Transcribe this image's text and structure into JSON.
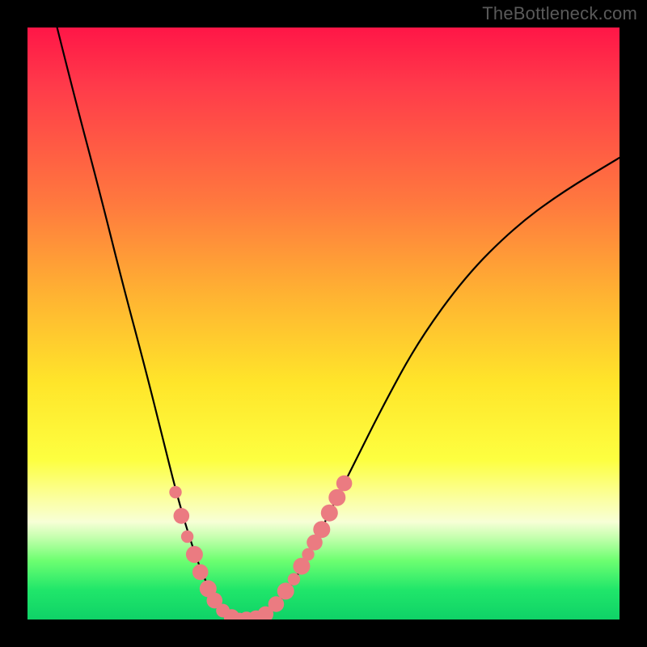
{
  "watermark": "TheBottleneck.com",
  "colors": {
    "frame": "#000000",
    "curve_stroke": "#000000",
    "bead_fill": "#eb7b81",
    "gradient_top": "#ff1647",
    "gradient_bottom": "#0fd267"
  },
  "chart_data": {
    "type": "line",
    "title": "",
    "xlabel": "",
    "ylabel": "",
    "xlim": [
      0,
      100
    ],
    "ylim": [
      0,
      100
    ],
    "series": [
      {
        "name": "bottleneck-curve",
        "x": [
          5,
          8,
          12,
          16,
          20,
          23,
          25,
          27,
          29,
          31,
          33,
          35,
          37,
          39,
          41,
          43,
          46,
          50,
          55,
          60,
          66,
          74,
          82,
          90,
          100
        ],
        "y": [
          100,
          88,
          73,
          57,
          42,
          30,
          22,
          15,
          9,
          4.5,
          1.5,
          0.2,
          0,
          0.3,
          1.5,
          3.5,
          8,
          16,
          26,
          36,
          47,
          58,
          66,
          72,
          78
        ]
      }
    ],
    "markers": [
      {
        "x": 25.0,
        "y": 21.5,
        "r": 1.1
      },
      {
        "x": 26.0,
        "y": 17.5,
        "r": 1.4
      },
      {
        "x": 27.0,
        "y": 14,
        "r": 1.1
      },
      {
        "x": 28.2,
        "y": 11,
        "r": 1.5
      },
      {
        "x": 29.2,
        "y": 8,
        "r": 1.4
      },
      {
        "x": 30.5,
        "y": 5.2,
        "r": 1.5
      },
      {
        "x": 31.6,
        "y": 3.2,
        "r": 1.4
      },
      {
        "x": 33,
        "y": 1.5,
        "r": 1.2
      },
      {
        "x": 34.5,
        "y": 0.4,
        "r": 1.4
      },
      {
        "x": 35.8,
        "y": 0.1,
        "r": 1.1
      },
      {
        "x": 37.0,
        "y": 0,
        "r": 1.4
      },
      {
        "x": 38.6,
        "y": 0.2,
        "r": 1.4
      },
      {
        "x": 40.2,
        "y": 0.9,
        "r": 1.4
      },
      {
        "x": 42.0,
        "y": 2.6,
        "r": 1.4
      },
      {
        "x": 43.6,
        "y": 4.8,
        "r": 1.5
      },
      {
        "x": 45.0,
        "y": 6.8,
        "r": 1.1
      },
      {
        "x": 46.3,
        "y": 9,
        "r": 1.5
      },
      {
        "x": 47.4,
        "y": 11,
        "r": 1.1
      },
      {
        "x": 48.5,
        "y": 13,
        "r": 1.4
      },
      {
        "x": 49.7,
        "y": 15.2,
        "r": 1.5
      },
      {
        "x": 51.0,
        "y": 18,
        "r": 1.5
      },
      {
        "x": 52.3,
        "y": 20.6,
        "r": 1.5
      },
      {
        "x": 53.5,
        "y": 23,
        "r": 1.4
      }
    ]
  }
}
